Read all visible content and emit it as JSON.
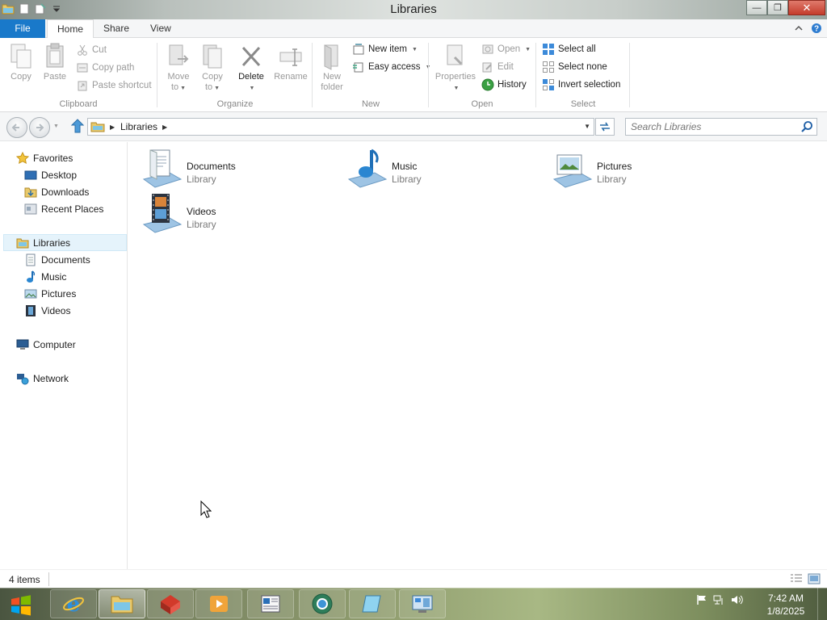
{
  "window": {
    "title": "Libraries"
  },
  "ribbon": {
    "tabs": {
      "file": "File",
      "home": "Home",
      "share": "Share",
      "view": "View"
    },
    "clipboard": {
      "label": "Clipboard",
      "copy": "Copy",
      "paste": "Paste",
      "cut": "Cut",
      "copy_path": "Copy path",
      "paste_shortcut": "Paste shortcut"
    },
    "organize": {
      "label": "Organize",
      "move_to_1": "Move",
      "move_to_2": "to",
      "copy_to_1": "Copy",
      "copy_to_2": "to",
      "delete": "Delete",
      "rename": "Rename"
    },
    "new": {
      "label": "New",
      "new_folder_1": "New",
      "new_folder_2": "folder",
      "new_item": "New item",
      "easy_access": "Easy access"
    },
    "open": {
      "label": "Open",
      "properties": "Properties",
      "open": "Open",
      "edit": "Edit",
      "history": "History"
    },
    "select": {
      "label": "Select",
      "select_all": "Select all",
      "select_none": "Select none",
      "invert_selection": "Invert selection"
    }
  },
  "address": {
    "path": "Libraries",
    "search_placeholder": "Search Libraries"
  },
  "navpane": {
    "favorites": "Favorites",
    "desktop": "Desktop",
    "downloads": "Downloads",
    "recent_places": "Recent Places",
    "libraries": "Libraries",
    "documents": "Documents",
    "music": "Music",
    "pictures": "Pictures",
    "videos": "Videos",
    "computer": "Computer",
    "network": "Network"
  },
  "content": {
    "items": [
      {
        "name": "Documents",
        "type": "Library",
        "icon": "documents-library-icon"
      },
      {
        "name": "Music",
        "type": "Library",
        "icon": "music-library-icon"
      },
      {
        "name": "Pictures",
        "type": "Library",
        "icon": "pictures-library-icon"
      },
      {
        "name": "Videos",
        "type": "Library",
        "icon": "videos-library-icon"
      }
    ]
  },
  "status": {
    "item_count": "4 items"
  },
  "taskbar": {
    "time": "7:42 AM",
    "date": "1/8/2025",
    "apps": [
      "internet-explorer",
      "file-explorer",
      "archive-app",
      "media-player",
      "document-viewer",
      "browser-globe",
      "notepad-app",
      "control-panel"
    ]
  },
  "colors": {
    "file_tab": "#1979ca",
    "close_button": "#c43c2b",
    "selection": "#e5f3fb"
  }
}
